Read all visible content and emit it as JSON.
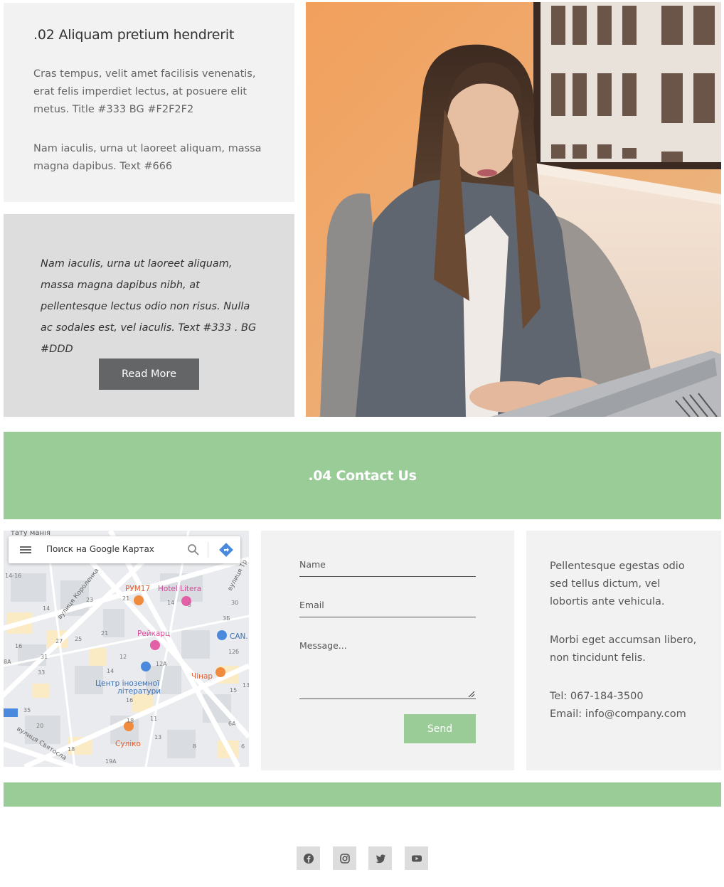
{
  "about": {
    "title": ".02 Aliquam pretium hendrerit",
    "para1": "Cras tempus, velit amet facilisis venenatis, erat felis imperdiet lectus, at posuere elit metus. Title #333 BG #F2F2F2",
    "para2": "Nam iaculis, urna ut laoreet aliquam, massa magna dapibus. Text #666"
  },
  "quote": {
    "text": "Nam iaculis, urna ut laoreet aliquam, massa magna dapibus nibh, at pellentesque lectus odio non risus. Nulla ac sodales est, vel iaculis. Text #333 . BG #DDD",
    "button_label": "Read More"
  },
  "contact": {
    "title": ".04 Contact Us"
  },
  "map": {
    "search_placeholder": "Поиск на Google Картах",
    "labels": {
      "rum17": "РУМ17",
      "hotel_litera": "Hotel Litera",
      "reikarts": "Рейкарц",
      "can": "CAN.",
      "centre_line1": "Центр іноземної",
      "centre_line2": "літератури",
      "chinar": "Чінар",
      "suliko": "Суліко",
      "street_korolenka": "вулиця Короленка",
      "street_sviatoslav": "вулиця Святосла",
      "top_left": "тату манія",
      "street_right": "вулиця Тр"
    }
  },
  "form": {
    "name_placeholder": "Name",
    "email_placeholder": "Email",
    "message_placeholder": "Message...",
    "send_label": "Send"
  },
  "info": {
    "para1": "Pellentesque egestas odio sed tellus dictum, vel lobortis ante vehicula.",
    "para2": "Morbi eget accumsan libero, non tincidunt felis.",
    "tel": "Tel: 067-184-3500",
    "email": "Email: info@company.com"
  },
  "social": {
    "icons": [
      "facebook-icon",
      "instagram-icon",
      "twitter-icon",
      "youtube-icon"
    ]
  },
  "colors": {
    "green_accent": "#9ACC98",
    "about_bg": "#F2F2F2",
    "quote_bg": "#DDDDDD",
    "button_bg": "#646566",
    "title_text": "#333333",
    "body_text": "#666666"
  }
}
